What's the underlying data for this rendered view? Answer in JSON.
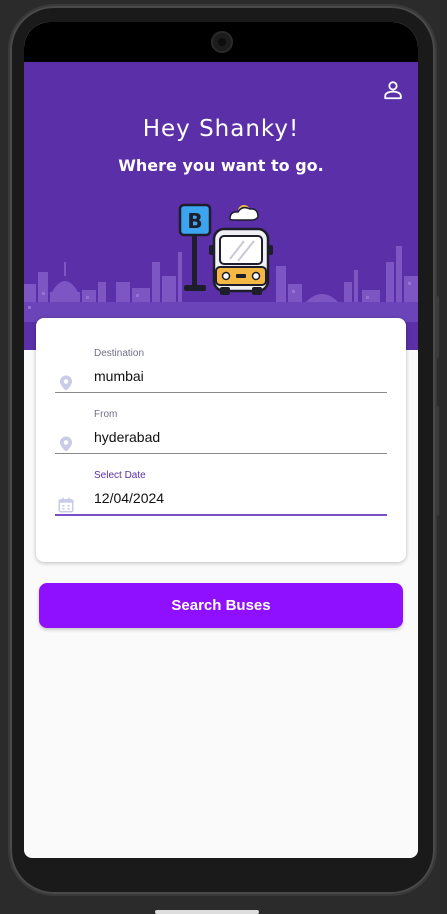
{
  "header": {
    "greeting": "Hey Shanky!",
    "subtitle": "Where you want to go.",
    "profile_icon": "person-icon",
    "bus_stop_letter": "B"
  },
  "form": {
    "destination": {
      "label": "Destination",
      "value": "mumbai",
      "icon": "location-pin-icon"
    },
    "from": {
      "label": "From",
      "value": "hyderabad",
      "icon": "location-pin-icon"
    },
    "date": {
      "label": "Select Date",
      "value": "12/04/2024",
      "icon": "calendar-icon"
    }
  },
  "search_button": {
    "label": "Search Buses"
  },
  "colors": {
    "header_bg": "#5b2fa7",
    "button_bg": "#8f10ff",
    "active_field": "#7a4fc9"
  }
}
